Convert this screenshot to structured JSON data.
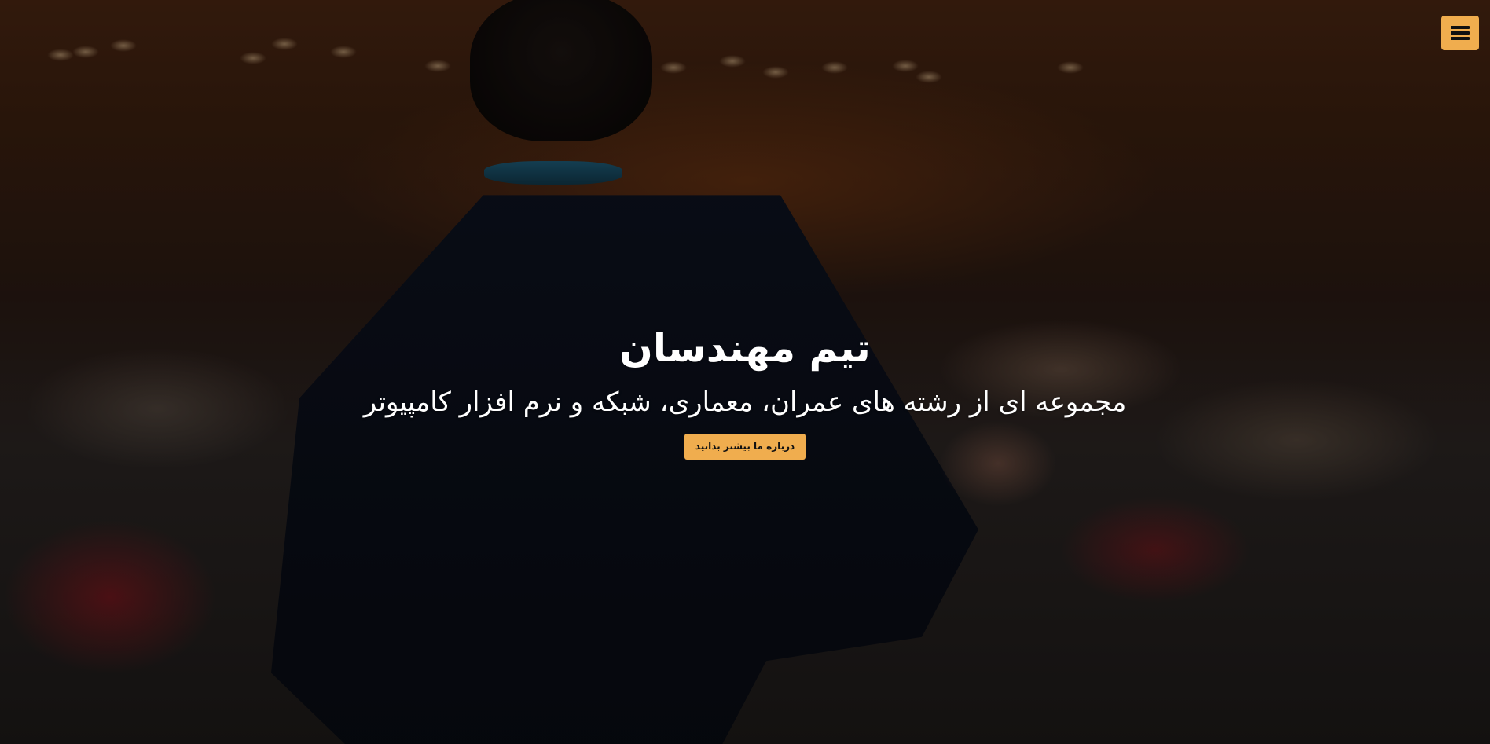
{
  "header": {
    "menu_icon": "hamburger-menu-icon"
  },
  "hero": {
    "background_image": "conference-speaker-photo",
    "title": "تیم مهندسان",
    "subtitle": "مجموعه ای از رشته های عمران، معماری، شبکه و نرم افزار کامپیوتر",
    "button_label": "درباره ما بیشتر بدانید"
  },
  "colors": {
    "accent": "#f0ad4e",
    "text": "#ffffff"
  }
}
